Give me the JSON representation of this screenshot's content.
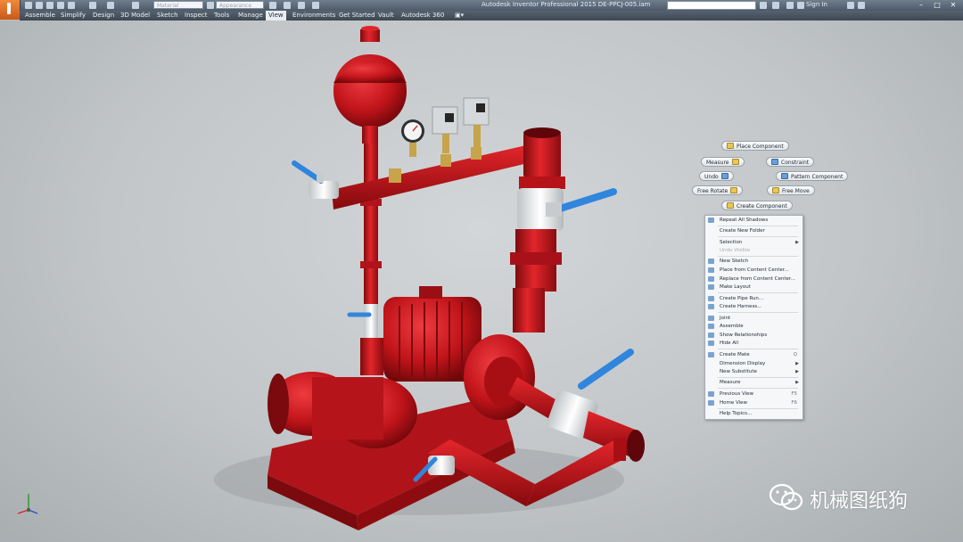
{
  "window": {
    "title": "Autodesk Inventor Professional 2015   DE-PPCJ-005.iam",
    "sign_in": "Sign In",
    "material_placeholder": "Material",
    "appearance_placeholder": "Appearance"
  },
  "menu": [
    {
      "label": "Assemble"
    },
    {
      "label": "Simplify"
    },
    {
      "label": "Design"
    },
    {
      "label": "3D Model"
    },
    {
      "label": "Sketch"
    },
    {
      "label": "Inspect"
    },
    {
      "label": "Tools"
    },
    {
      "label": "Manage"
    },
    {
      "label": "View"
    },
    {
      "label": "Environments"
    },
    {
      "label": "Get Started"
    },
    {
      "label": "Vault"
    },
    {
      "label": "Autodesk 360"
    }
  ],
  "marking_menu": {
    "place_component": "Place Component",
    "measure": "Measure",
    "constraint": "Constraint",
    "undo": "Undo",
    "pattern_component": "Pattern Component",
    "free_rotate": "Free Rotate",
    "free_move": "Free Move",
    "create_component": "Create Component"
  },
  "context_menu": {
    "repeat_all_shadows": "Repeat All Shadows",
    "create_new_folder": "Create New Folder",
    "selection": "Selection",
    "undo_visible": "Undo Visible",
    "new_sketch": "New Sketch",
    "place_from_content_center": "Place from Content Center...",
    "replace_from_content_center": "Replace from Content Center...",
    "make_layout": "Make Layout",
    "create_pipe_run": "Create Pipe Run...",
    "create_harness": "Create Harness...",
    "joint": "Joint",
    "assemble": "Assemble",
    "show_relationships": "Show Relationships",
    "hide_all": "Hide All",
    "create_mate": "Create Mate",
    "create_mate_shortcut": "Q",
    "dimension_display": "Dimension Display",
    "new_substitute": "New Substitute",
    "measure": "Measure",
    "previous_view": "Previous View",
    "previous_view_shortcut": "F5",
    "home_view": "Home View",
    "home_view_shortcut": "F6",
    "help_topics": "Help Topics..."
  },
  "watermark": {
    "text": "机械图纸狗"
  },
  "colors": {
    "pipe_red": "#c8141a",
    "valve_handle_blue": "#3f8fe0",
    "viewport_bg": "#c4c8ca",
    "ribbon_dark": "#3d4752"
  },
  "icons": {
    "app_menu": "inventor-app-icon",
    "watermark_logo": "wechat-icon",
    "triad": "view-triad-icon"
  }
}
